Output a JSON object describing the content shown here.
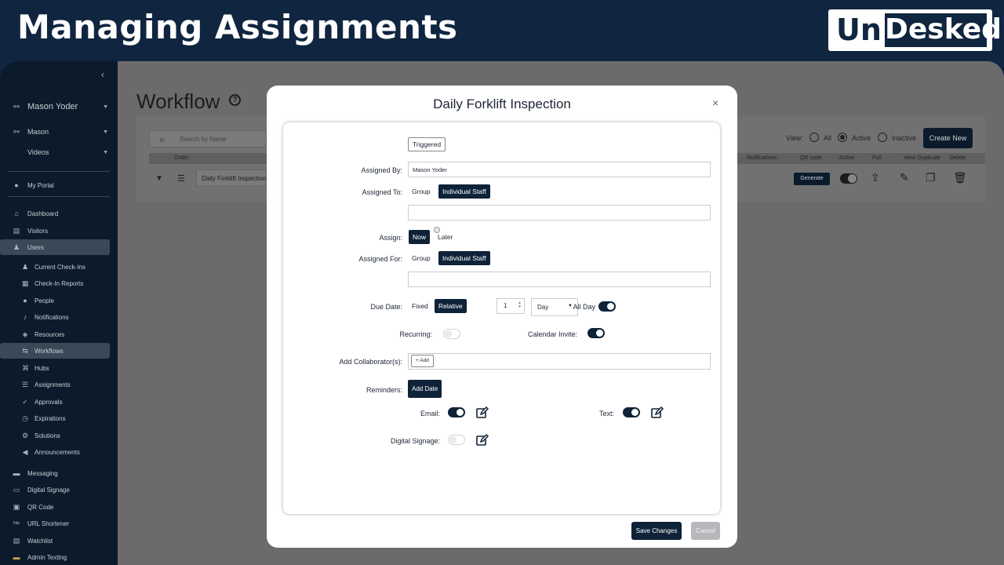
{
  "banner": {
    "title": "Managing Assignments",
    "logo_un": "Un",
    "logo_desked": "Desked"
  },
  "sidebar": {
    "collapse": "‹",
    "account": "Mason Yoder",
    "org": "Mason",
    "videos": "Videos",
    "my_portal": "My Portal",
    "items": [
      {
        "label": "Dashboard"
      },
      {
        "label": "Visitors"
      },
      {
        "label": "Users"
      },
      {
        "label": "Current Check-Ins"
      },
      {
        "label": "Check-In Reports"
      },
      {
        "label": "People"
      },
      {
        "label": "Notifications"
      },
      {
        "label": "Resources"
      },
      {
        "label": "Workflows"
      },
      {
        "label": "Hubs"
      },
      {
        "label": "Assignments"
      },
      {
        "label": "Approvals"
      },
      {
        "label": "Expirations"
      },
      {
        "label": "Solutions"
      },
      {
        "label": "Announcements"
      },
      {
        "label": "Messaging"
      },
      {
        "label": "Digital Signage"
      },
      {
        "label": "QR Code"
      },
      {
        "label": "URL Shortener"
      },
      {
        "label": "Watchlist"
      },
      {
        "label": "Admin Texting"
      }
    ]
  },
  "workflow": {
    "title": "Workflow",
    "search_placeholder": "Search by Name",
    "columns": [
      "Order",
      "Notifications",
      "QR code",
      "Active",
      "Pull",
      "View",
      "Duplicate",
      "Delete"
    ],
    "row_name": "Daily Forklift Inspection",
    "view_label": "View:",
    "view_options": [
      "All",
      "Active",
      "Inactive"
    ],
    "create_new": "Create New",
    "generate": "Generate"
  },
  "modal": {
    "title": "Daily Forklift Inspection",
    "close": "×",
    "triggered": "Triggered",
    "assigned_by_label": "Assigned By:",
    "assigned_by_value": "Mason Yoder",
    "assigned_to_label": "Assigned To:",
    "group": "Group",
    "individual_staff": "Individual Staff",
    "assign_label": "Assign:",
    "now": "Now",
    "later": "Later",
    "assigned_for_label": "Assigned For:",
    "due_date_label": "Due Date:",
    "fixed": "Fixed",
    "relative": "Relative",
    "due_number": "1",
    "due_unit": "Day",
    "all_day": "All Day",
    "recurring": "Recurring:",
    "calendar_invite": "Calendar Invite:",
    "add_collaborators": "Add Collaborator(s):",
    "add": "+ Add",
    "reminders": "Reminders:",
    "add_date": "Add Date",
    "email": "Email:",
    "text": "Text:",
    "digital_signage": "Digital Signage:",
    "save": "Save Changes",
    "cancel": "Cancel"
  }
}
